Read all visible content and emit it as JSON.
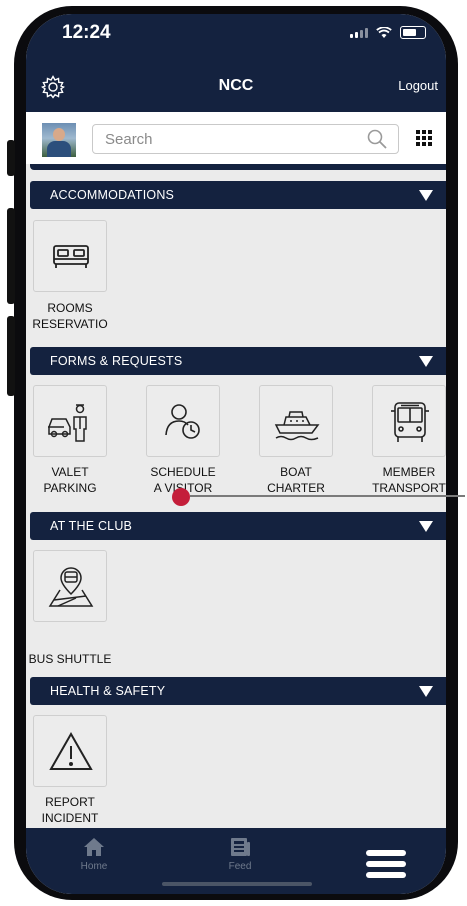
{
  "status_bar": {
    "time": "12:24"
  },
  "app_bar": {
    "title": "NCC",
    "logout_label": "Logout",
    "settings_icon": "gear-icon"
  },
  "search": {
    "placeholder": "Search"
  },
  "sections": [
    {
      "title": "ACCOMMODATIONS",
      "items": [
        {
          "label": "ROOMS\nRESERVATIO",
          "icon": "bed-icon"
        }
      ]
    },
    {
      "title": "FORMS & REQUESTS",
      "items": [
        {
          "label": "VALET\nPARKING",
          "icon": "valet-icon"
        },
        {
          "label": "SCHEDULE\nA VISITOR",
          "icon": "visitor-clock-icon"
        },
        {
          "label": "BOAT\nCHARTER",
          "icon": "boat-icon"
        },
        {
          "label": "MEMBER\nTRANSPORT",
          "icon": "bus-icon"
        }
      ]
    },
    {
      "title": "AT THE CLUB",
      "items": [
        {
          "label": "BUS SHUTTLE",
          "icon": "shuttle-map-icon"
        }
      ]
    },
    {
      "title": "HEALTH & SAFETY",
      "items": [
        {
          "label": "REPORT\nINCIDENT",
          "icon": "warning-icon"
        }
      ]
    }
  ],
  "bottom_nav": [
    {
      "label": "Home",
      "icon": "home-icon"
    },
    {
      "label": "Feed",
      "icon": "feed-icon"
    },
    {
      "label": "",
      "icon": "menu-icon"
    }
  ],
  "colors": {
    "navy": "#14223f",
    "background": "#ebebeb",
    "marker": "#c41e3a"
  }
}
